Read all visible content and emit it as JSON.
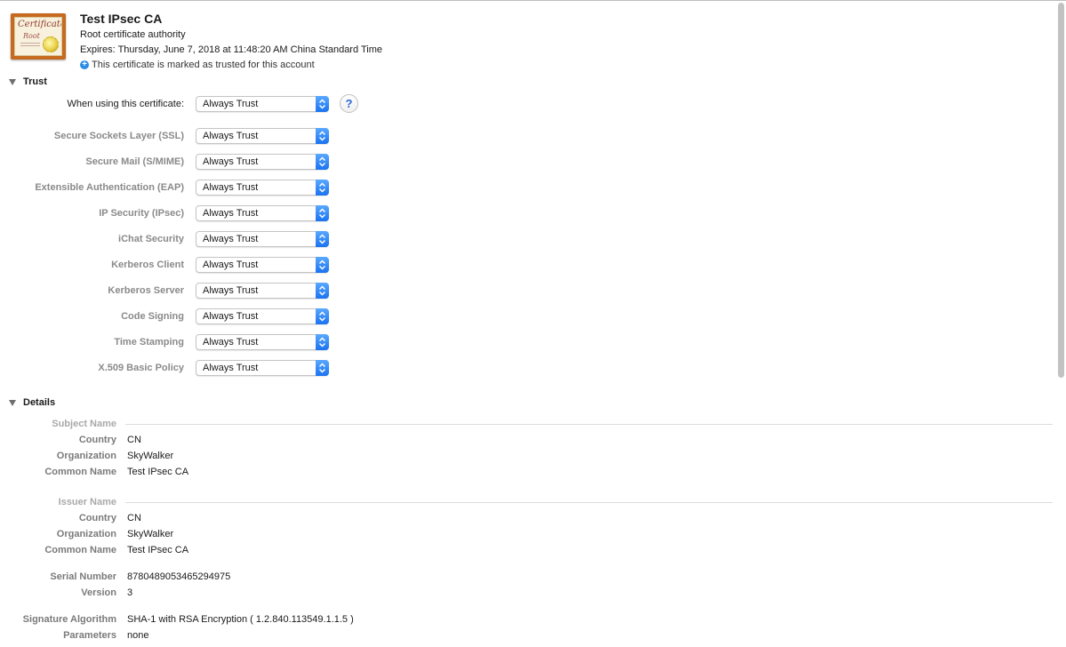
{
  "certificate": {
    "title": "Test IPsec CA",
    "subtitle": "Root certificate authority",
    "expires": "Expires: Thursday, June 7, 2018 at 11:48:20 AM China Standard Time",
    "trusted_note": "This certificate is marked as trusted for this account",
    "icon_text": "Certificate",
    "icon_root": "Root"
  },
  "trust": {
    "header": "Trust",
    "main_label": "When using this certificate:",
    "main_value": "Always Trust",
    "help_label": "?",
    "rows": [
      {
        "label": "Secure Sockets Layer (SSL)",
        "value": "Always Trust"
      },
      {
        "label": "Secure Mail (S/MIME)",
        "value": "Always Trust"
      },
      {
        "label": "Extensible Authentication (EAP)",
        "value": "Always Trust"
      },
      {
        "label": "IP Security (IPsec)",
        "value": "Always Trust"
      },
      {
        "label": "iChat Security",
        "value": "Always Trust"
      },
      {
        "label": "Kerberos Client",
        "value": "Always Trust"
      },
      {
        "label": "Kerberos Server",
        "value": "Always Trust"
      },
      {
        "label": "Code Signing",
        "value": "Always Trust"
      },
      {
        "label": "Time Stamping",
        "value": "Always Trust"
      },
      {
        "label": "X.509 Basic Policy",
        "value": "Always Trust"
      }
    ]
  },
  "details": {
    "header": "Details",
    "subject": {
      "title": "Subject Name",
      "fields": [
        {
          "label": "Country",
          "value": "CN"
        },
        {
          "label": "Organization",
          "value": "SkyWalker"
        },
        {
          "label": "Common Name",
          "value": "Test IPsec CA"
        }
      ]
    },
    "issuer": {
      "title": "Issuer Name",
      "fields": [
        {
          "label": "Country",
          "value": "CN"
        },
        {
          "label": "Organization",
          "value": "SkyWalker"
        },
        {
          "label": "Common Name",
          "value": "Test IPsec CA"
        }
      ]
    },
    "serial": {
      "label": "Serial Number",
      "value": "8780489053465294975"
    },
    "version": {
      "label": "Version",
      "value": "3"
    },
    "signature_algorithm": {
      "label": "Signature Algorithm",
      "value": "SHA-1 with RSA Encryption ( 1.2.840.113549.1.1.5 )"
    },
    "parameters": {
      "label": "Parameters",
      "value": "none"
    }
  },
  "colors": {
    "accent": "#1a72f0",
    "label_gray": "#8a8a8a",
    "info_blue": "#2b8ce6"
  }
}
